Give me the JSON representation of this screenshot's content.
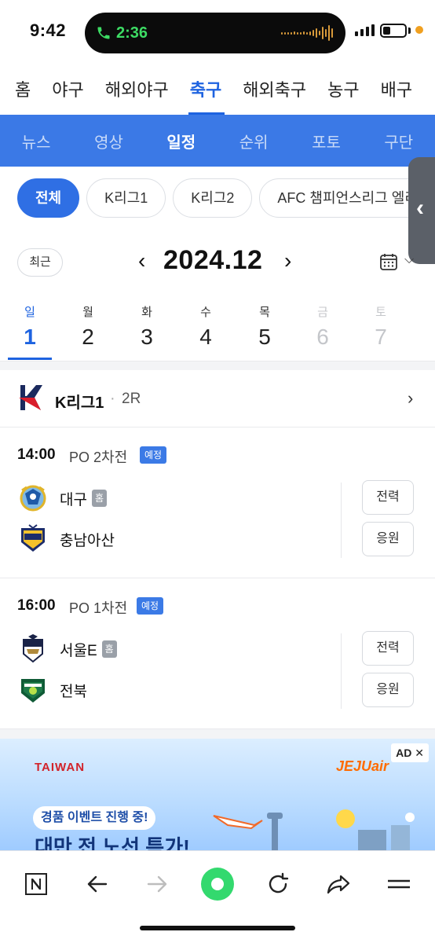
{
  "status": {
    "time": "9:42",
    "call_time": "2:36"
  },
  "sport_tabs": [
    "홈",
    "야구",
    "해외야구",
    "축구",
    "해외축구",
    "농구",
    "배구"
  ],
  "sub_nav": [
    "뉴스",
    "영상",
    "일정",
    "순위",
    "포토",
    "구단"
  ],
  "chips": [
    "전체",
    "K리그1",
    "K리그2",
    "AFC 챔피언스리그 엘리"
  ],
  "month": {
    "recent": "최근",
    "title": "2024.12"
  },
  "days": [
    {
      "name": "일",
      "date": "1"
    },
    {
      "name": "월",
      "date": "2"
    },
    {
      "name": "화",
      "date": "3"
    },
    {
      "name": "수",
      "date": "4"
    },
    {
      "name": "목",
      "date": "5"
    },
    {
      "name": "금",
      "date": "6"
    },
    {
      "name": "토",
      "date": "7"
    }
  ],
  "league": {
    "name": "K리그1",
    "round": "2R"
  },
  "matches": [
    {
      "time": "14:00",
      "stage": "PO 2차전",
      "status": "예정",
      "home_team": "대구",
      "home_badge": "홈",
      "away_team": "충남아산",
      "btn_analysis": "전력",
      "btn_cheer": "응원"
    },
    {
      "time": "16:00",
      "stage": "PO 1차전",
      "status": "예정",
      "home_team": "서울E",
      "home_badge": "홈",
      "away_team": "전북",
      "btn_analysis": "전력",
      "btn_cheer": "응원"
    }
  ],
  "ad": {
    "badge": "AD ✕",
    "brand_left": "TAIWAN",
    "brand_right": "JEJUair",
    "pill": "경품 이벤트 진행 중!",
    "headline": "대만 전 노선 특가!"
  },
  "colors": {
    "accent": "#1e63e0",
    "subnav_bg": "#3b79e6"
  }
}
